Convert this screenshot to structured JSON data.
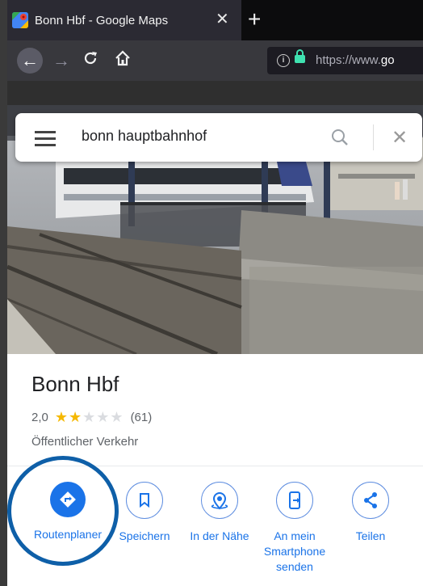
{
  "browser": {
    "tab_title": "Bonn Hbf - Google Maps",
    "tab_close": "✕",
    "new_tab": "+",
    "url_prefix": "https://www.",
    "url_domain": "go"
  },
  "search": {
    "query": "bonn hauptbahnhof"
  },
  "place": {
    "name": "Bonn Hbf",
    "rating": "2,0",
    "rating_value": 2,
    "rating_max": 5,
    "review_count": "(61)",
    "category": "Öffentlicher Verkehr"
  },
  "actions": [
    {
      "label": "Routenplaner",
      "icon": "directions-icon"
    },
    {
      "label": "Speichern",
      "icon": "bookmark-icon"
    },
    {
      "label": "In der Nähe",
      "icon": "nearby-icon"
    },
    {
      "label": "An mein Smartphone senden",
      "icon": "send-to-phone-icon"
    },
    {
      "label": "Teilen",
      "icon": "share-icon"
    }
  ],
  "colors": {
    "accent": "#1a73e8",
    "highlight_ring": "#0e5fa8",
    "star": "#f5b800"
  }
}
